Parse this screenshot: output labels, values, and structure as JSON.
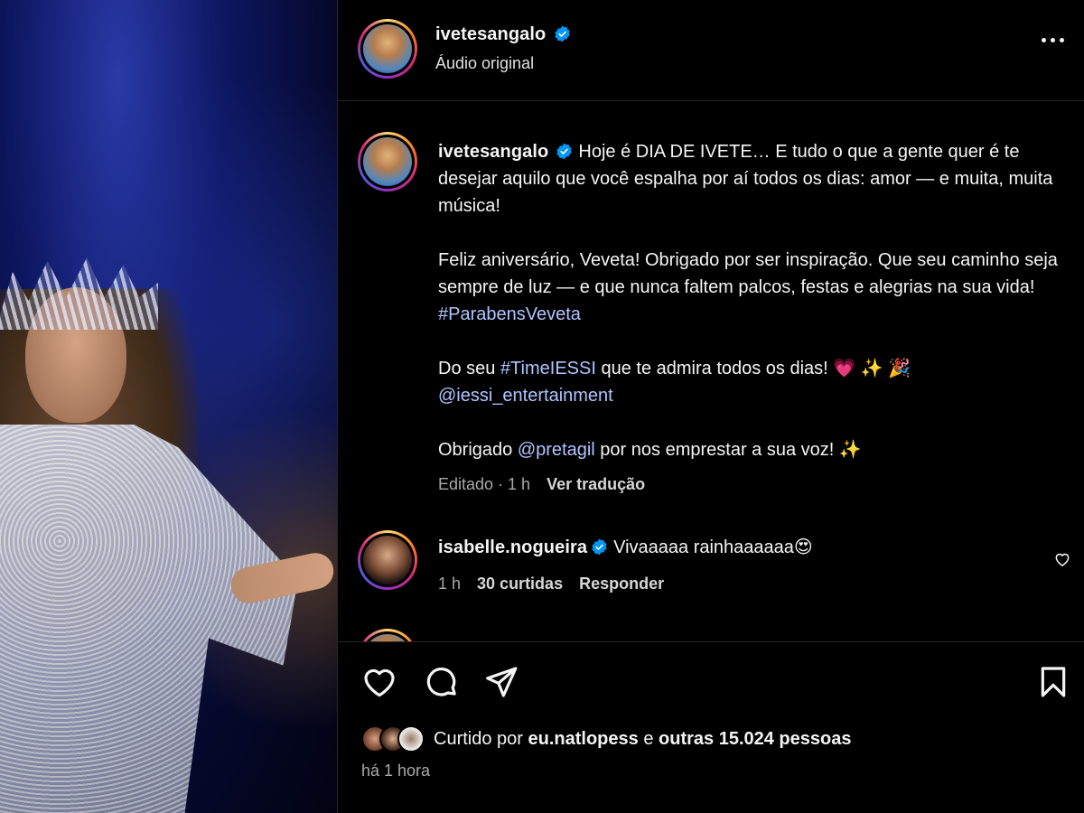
{
  "post": {
    "author": "ivetesangalo",
    "audio": "Áudio original"
  },
  "caption": {
    "author": "ivetesangalo",
    "p1": "Hoje é DIA DE IVETE… E tudo o que a gente quer é te desejar aquilo que você espalha por aí todos os dias: amor — e muita, muita música!",
    "p2_text": "Feliz aniversário, Veveta! Obrigado por ser inspiração. Que seu caminho seja sempre de luz — e que nunca faltem palcos, festas e alegrias na sua vida! ",
    "p2_hashtag": "#ParabensVeveta",
    "p3_prefix": "Do seu ",
    "p3_hashtag": "#TimeIESSI",
    "p3_text": " que te admira todos os dias! 💗 ✨ 🎉",
    "p3_mention": "@iessi_entertainment",
    "p4_prefix": "Obrigado ",
    "p4_mention": "@pretagil",
    "p4_text": " por nos emprestar a sua voz! ✨",
    "edited": "Editado · 1 h",
    "translate": "Ver tradução"
  },
  "comment": {
    "author": "isabelle.nogueira",
    "text": "Vivaaaaa rainhaaaaaa😍",
    "time": "1 h",
    "likes": "30 curtidas",
    "reply": "Responder"
  },
  "footer": {
    "liked_prefix": "Curtido por ",
    "liked_user": "eu.natlopess",
    "liked_middle": " e ",
    "liked_others": "outras 15.024 pessoas",
    "time": "há 1 hora"
  },
  "colors": {
    "verified": "#0095f6",
    "link": "#b0c4ff",
    "background": "#000000"
  }
}
